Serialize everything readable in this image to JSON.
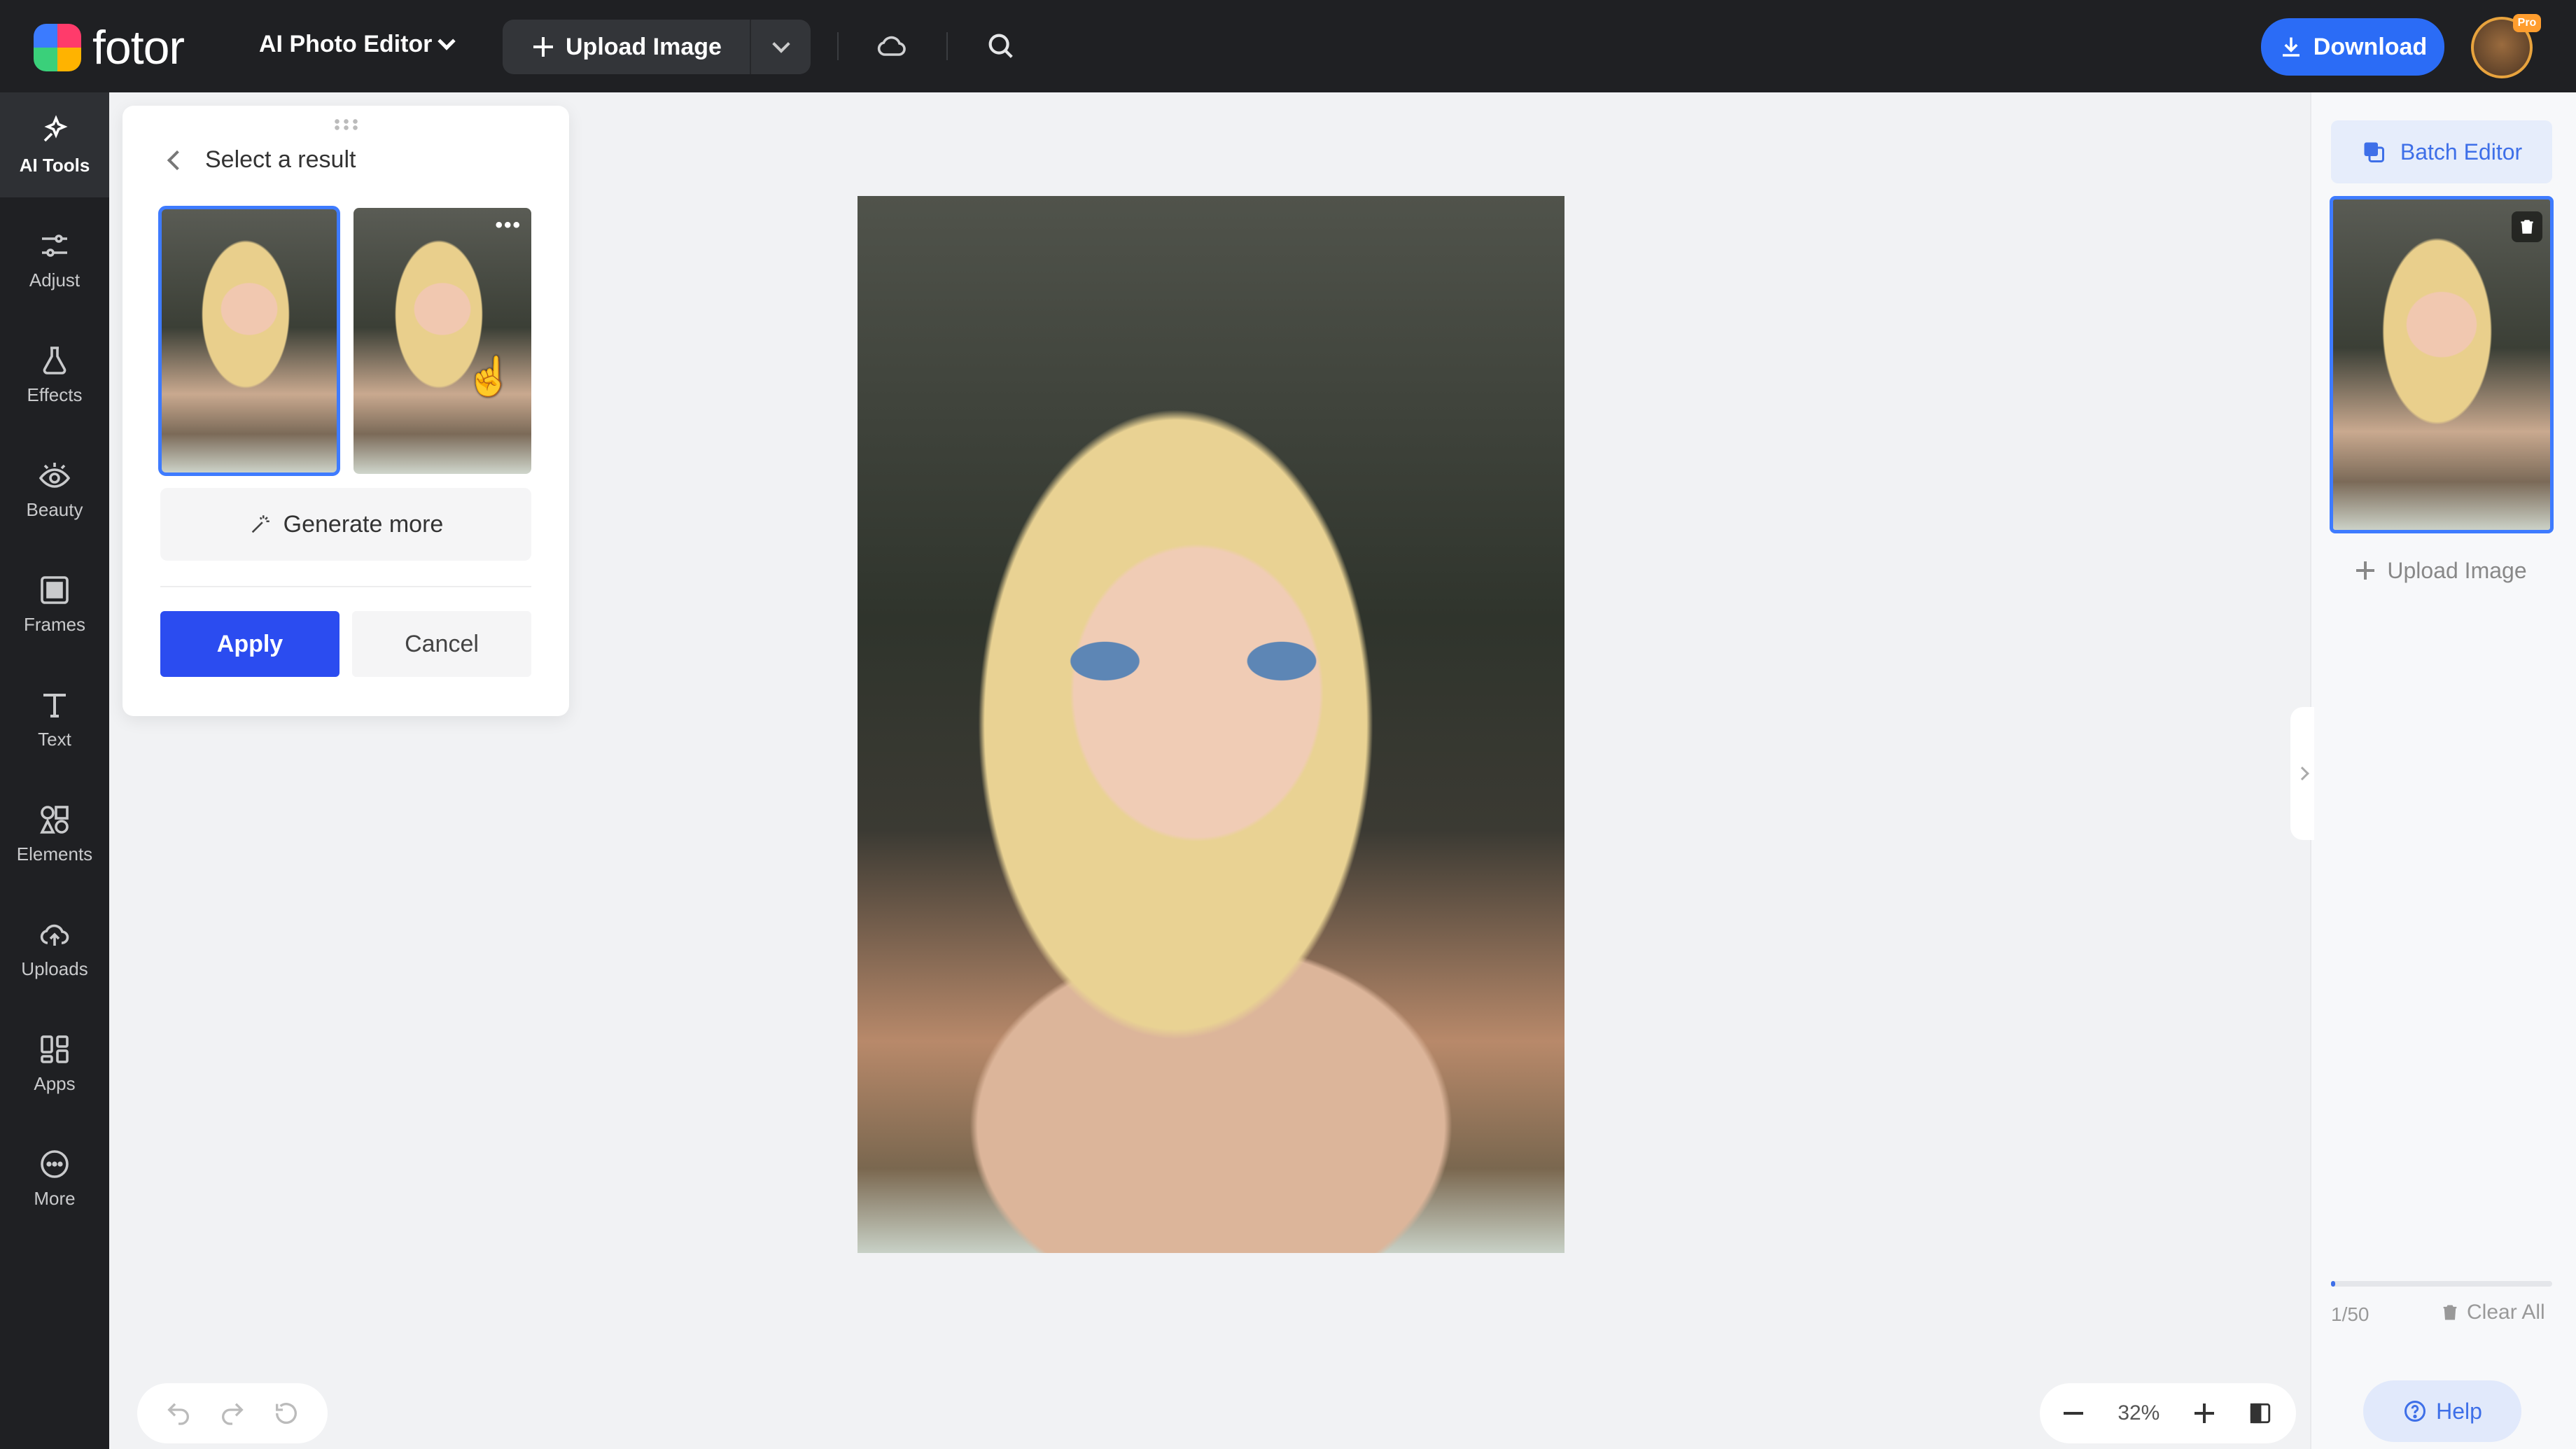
{
  "app": {
    "logo_text": "fotor",
    "editor_menu": "AI Photo Editor",
    "upload_label": "Upload Image",
    "download_label": "Download",
    "pro_badge": "Pro"
  },
  "sidebar": {
    "items": [
      {
        "label": "AI Tools",
        "icon": "ai-tools-icon",
        "active": true
      },
      {
        "label": "Adjust",
        "icon": "sliders-icon"
      },
      {
        "label": "Effects",
        "icon": "flask-icon"
      },
      {
        "label": "Beauty",
        "icon": "eye-icon"
      },
      {
        "label": "Frames",
        "icon": "frame-icon"
      },
      {
        "label": "Text",
        "icon": "text-icon"
      },
      {
        "label": "Elements",
        "icon": "shapes-icon"
      },
      {
        "label": "Uploads",
        "icon": "cloud-upload-icon"
      },
      {
        "label": "Apps",
        "icon": "apps-icon"
      },
      {
        "label": "More",
        "icon": "more-icon"
      }
    ]
  },
  "result_panel": {
    "title": "Select a result",
    "generate_more": "Generate more",
    "apply": "Apply",
    "cancel": "Cancel",
    "results": [
      {
        "selected": true
      },
      {
        "selected": false
      }
    ]
  },
  "right_panel": {
    "batch_editor": "Batch Editor",
    "upload_label": "Upload Image",
    "count": "1/50",
    "progress": 0.02,
    "clear_all": "Clear All",
    "help": "Help"
  },
  "zoom": {
    "level": "32%"
  },
  "colors": {
    "accent": "#2b4cf0",
    "download": "#2b6cf6",
    "topbar": "#1f2023"
  }
}
